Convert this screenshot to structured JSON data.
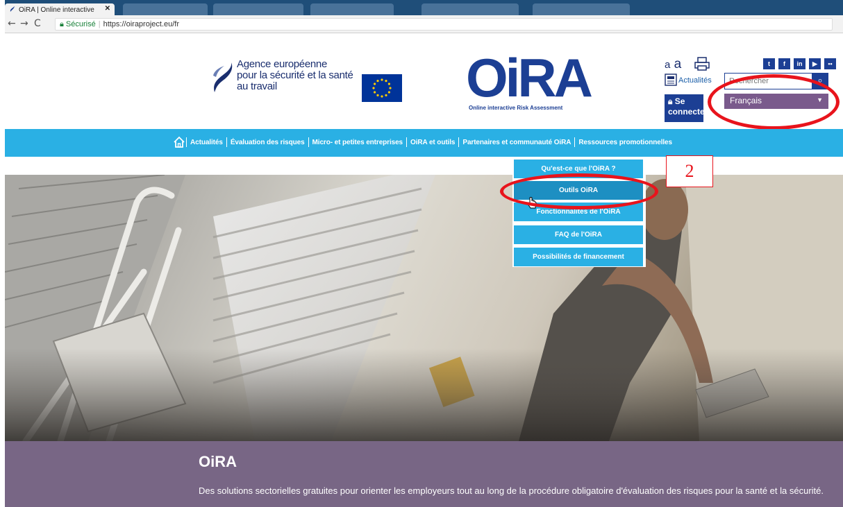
{
  "browser": {
    "active_tab": "OiRA | Online interactive",
    "active_tab_close": "✕",
    "back": "←",
    "forward": "→",
    "reload": "C",
    "secure_label": "Sécurisé",
    "url": "https://oiraproject.eu/fr"
  },
  "header": {
    "agency_line1": "Agence européenne",
    "agency_line2": "pour la sécurité et la santé",
    "agency_line3": "au travail",
    "logo_word": "OiRA",
    "logo_sub": "Online interactive Risk Assessment",
    "font_small": "a",
    "font_large": "a",
    "news_label": "Actualités",
    "search_placeholder": "Rechercher",
    "search_icon": "search-icon",
    "login_label": "Se connecter",
    "language": "Français",
    "social": [
      "t",
      "f",
      "in",
      "▶",
      "••"
    ]
  },
  "nav": {
    "items": [
      "Actualités",
      "Évaluation des risques",
      "Micro- et petites entreprises",
      "OiRA et outils",
      "Partenaires et communauté OiRA",
      "Ressources promotionnelles"
    ]
  },
  "dropdown": {
    "items": [
      "Qu'est-ce que l'OiRA ?",
      "Outils OiRA",
      "Fonctionnalités de l'OiRA",
      "FAQ de l'OiRA",
      "Possibilités de financement"
    ]
  },
  "annotation": {
    "callout_number": "2"
  },
  "banner": {
    "title": "OiRA",
    "text": "Des solutions sectorielles gratuites pour orienter les employeurs tout au long de la procédure obligatoire d'évaluation des risques pour la santé et la sécurité."
  },
  "colors": {
    "nav_blue": "#2ab0e4",
    "brand_navy": "#1c3f94",
    "banner_purple": "#786685",
    "annotation_red": "#e8141c"
  }
}
